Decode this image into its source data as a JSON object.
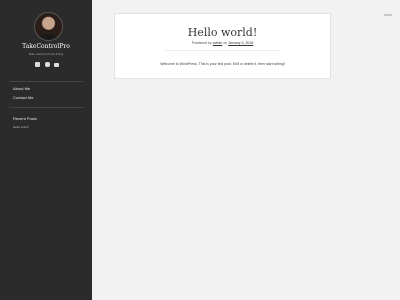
{
  "site": {
    "title": "TakeControlPro",
    "description": "Take Control of Life & Pay"
  },
  "social_icons": [
    "facebook-icon",
    "instagram-icon",
    "email-icon"
  ],
  "nav": {
    "items": [
      {
        "label": "About Me"
      },
      {
        "label": "Contact Me"
      }
    ]
  },
  "widgets": {
    "recent_posts_title": "Recent Posts",
    "recent_posts": [
      {
        "label": "Hello world!"
      }
    ]
  },
  "post": {
    "title": "Hello world!",
    "meta_prefix": "Published by",
    "author": "admin",
    "meta_on": "on",
    "date": "January 4, 2018",
    "body": "Welcome to WordPress. This is your first post. Edit or delete it, then start writing!"
  },
  "colors": {
    "sidebar_bg": "#2b2b2b",
    "page_bg": "#f2f2f2",
    "card_bg": "#ffffff"
  }
}
